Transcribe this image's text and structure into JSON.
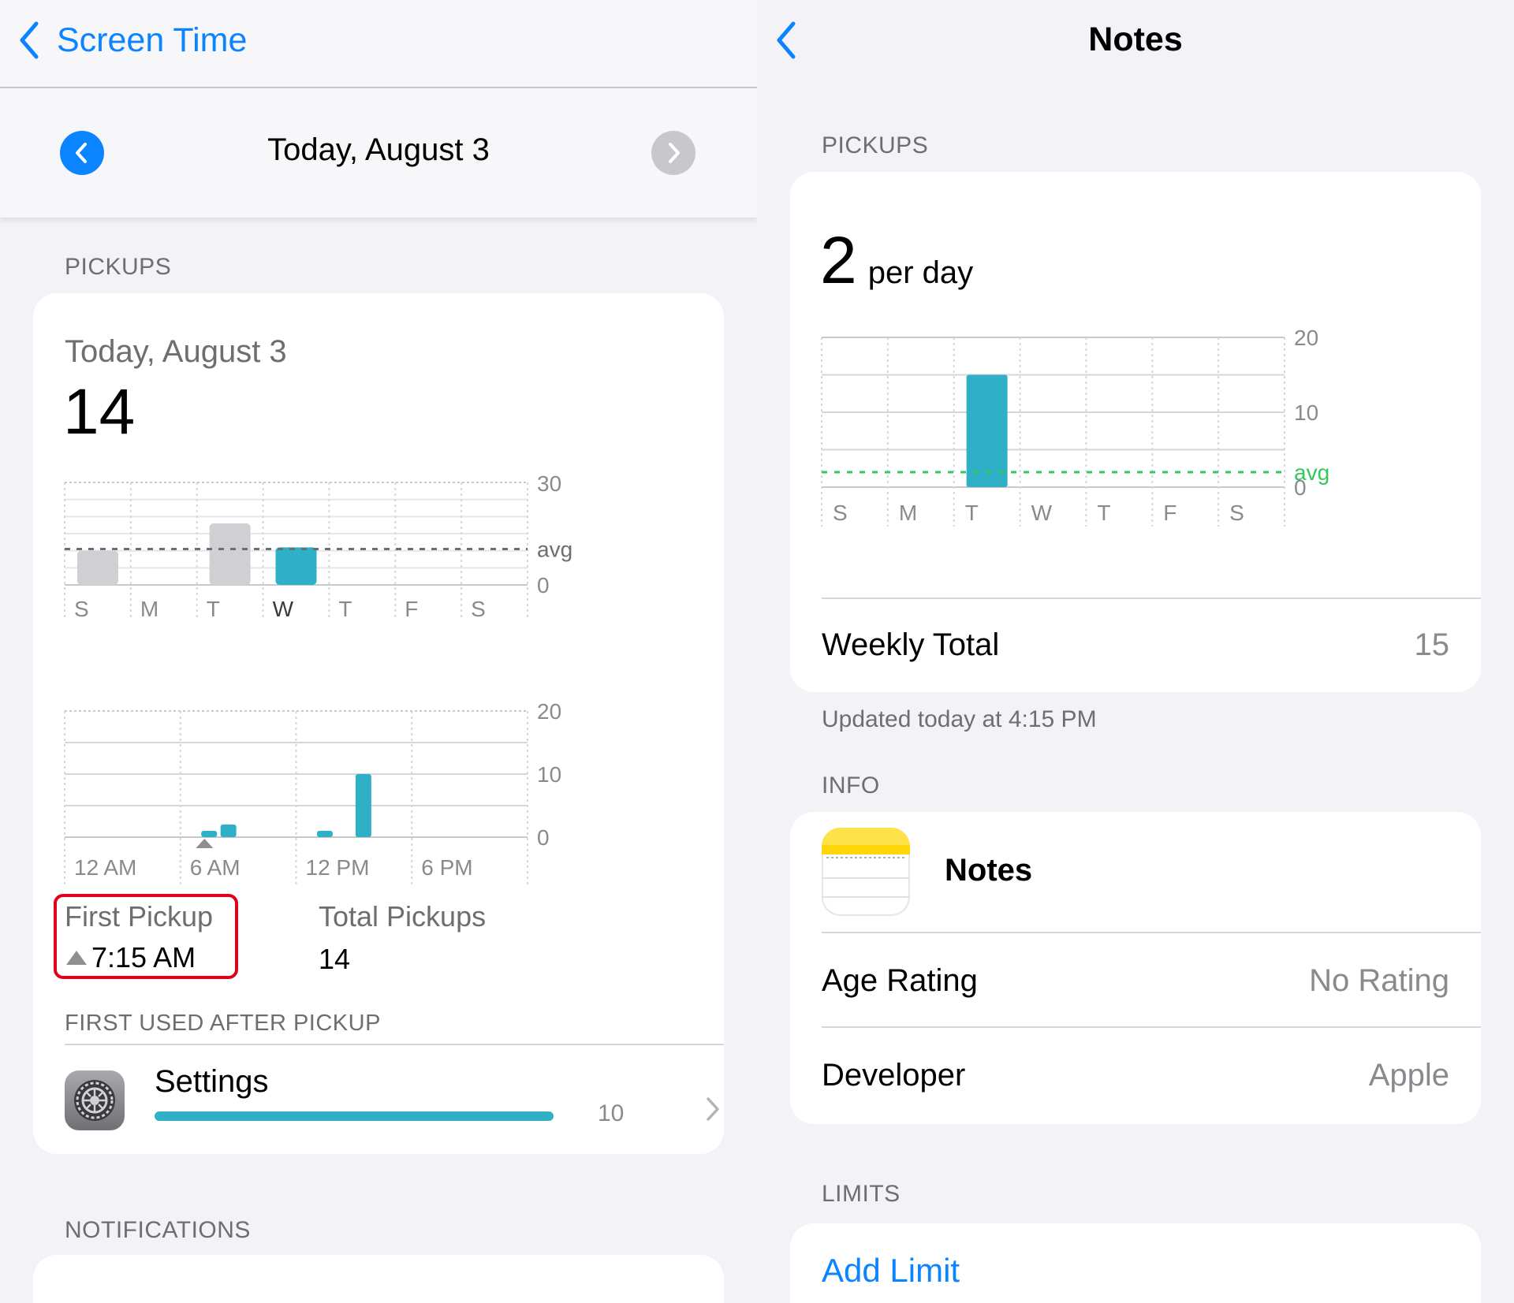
{
  "left": {
    "nav": {
      "back_label": "Screen Time"
    },
    "date_bar": {
      "title": "Today, August 3"
    },
    "pickups_section_label": "PICKUPS",
    "pickups_card": {
      "date": "Today, August 3",
      "count": "14",
      "first_pickup_label": "First Pickup",
      "first_pickup_value": "7:15 AM",
      "total_pickups_label": "Total Pickups",
      "total_pickups_value": "14"
    },
    "first_used_label": "FIRST USED AFTER PICKUP",
    "first_used_item": {
      "name": "Settings",
      "count": "10",
      "bar_fraction": 1.0
    },
    "notifications_label": "NOTIFICATIONS"
  },
  "right": {
    "nav": {
      "title": "Notes"
    },
    "pickups_section_label": "PICKUPS",
    "pickups_card": {
      "avg_value": "2",
      "avg_unit": "per day",
      "weekly_total_label": "Weekly Total",
      "weekly_total_value": "15"
    },
    "updated_text": "Updated today at 4:15 PM",
    "info_label": "INFO",
    "info": {
      "app_name": "Notes",
      "age_rating_label": "Age Rating",
      "age_rating_value": "No Rating",
      "developer_label": "Developer",
      "developer_value": "Apple"
    },
    "limits_label": "LIMITS",
    "add_limit_label": "Add Limit"
  },
  "colors": {
    "accent_blue": "#0a84ff",
    "teal_bar": "#30b0c7",
    "gray_bar": "#cfcfd4",
    "avg_green": "#34c759",
    "highlight_red": "#e0001a"
  },
  "chart_data": [
    {
      "type": "bar",
      "categories": [
        "S",
        "M",
        "T",
        "W",
        "T",
        "F",
        "S"
      ],
      "values": [
        10,
        0,
        18,
        11,
        0,
        0,
        0
      ],
      "highlight_index": 3,
      "ylim": [
        0,
        30
      ],
      "yticks": [
        "30",
        "avg",
        "0"
      ],
      "avg": 10.5,
      "grid": true
    },
    {
      "type": "bar",
      "categories": [
        "12 AM",
        "6 AM",
        "12 PM",
        "6 PM"
      ],
      "hourly_values": [
        {
          "hour": 7,
          "value": 1
        },
        {
          "hour": 8,
          "value": 2
        },
        {
          "hour": 13,
          "value": 1
        },
        {
          "hour": 15,
          "value": 10
        }
      ],
      "first_pickup_hour": 7.25,
      "ylim": [
        0,
        20
      ],
      "yticks": [
        "20",
        "10",
        "0"
      ],
      "grid": true
    },
    {
      "type": "bar",
      "categories": [
        "S",
        "M",
        "T",
        "W",
        "T",
        "F",
        "S"
      ],
      "values": [
        0,
        0,
        15,
        0,
        0,
        0,
        0
      ],
      "ylim": [
        0,
        20
      ],
      "yticks": [
        "20",
        "10",
        "avg",
        "0"
      ],
      "avg": 2,
      "grid": true
    }
  ]
}
